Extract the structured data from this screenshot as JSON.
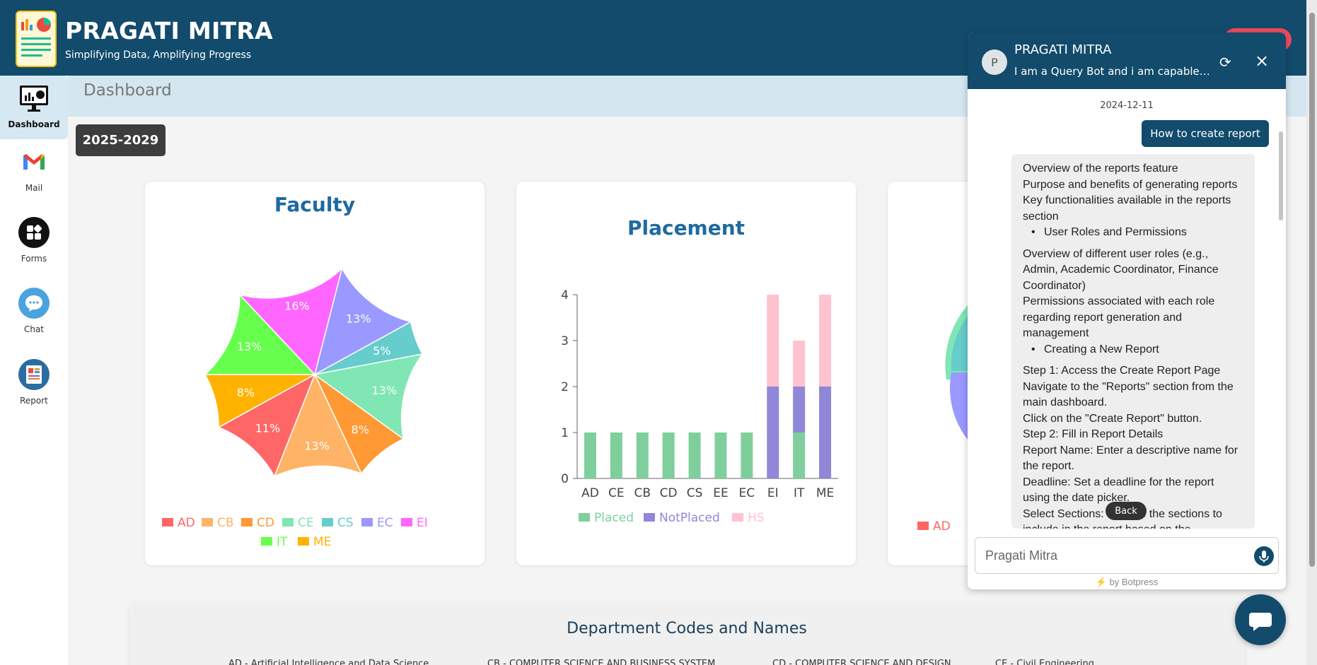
{
  "header": {
    "brand_title": "PRAGATI MITRA",
    "brand_subtitle": "Simplifying Data, Amplifying Progress"
  },
  "sidebar": {
    "items": [
      {
        "label": "Dashboard",
        "icon": "dashboard-monitor-icon",
        "active": true
      },
      {
        "label": "Mail",
        "icon": "gmail-icon"
      },
      {
        "label": "Forms",
        "icon": "forms-grid-icon"
      },
      {
        "label": "Chat",
        "icon": "chat-bubble-icon"
      },
      {
        "label": "Report",
        "icon": "report-icon"
      }
    ]
  },
  "dashboard": {
    "title": "Dashboard",
    "year": "2025-2029"
  },
  "faculty_card": {
    "title": "Faculty",
    "chart_data": {
      "type": "pie",
      "slices": [
        {
          "label": "IT",
          "value": 13,
          "color": "#66ff4d"
        },
        {
          "label": "EI",
          "value": 16,
          "color": "#ff66ff"
        },
        {
          "label": "EC",
          "value": 13,
          "color": "#9999ff"
        },
        {
          "label": "CS",
          "value": 5,
          "color": "#66cccc"
        },
        {
          "label": "CE",
          "value": 13,
          "color": "#80e6b3"
        },
        {
          "label": "CD",
          "value": 8,
          "color": "#ff9933"
        },
        {
          "label": "CB",
          "value": 13,
          "color": "#ffb366"
        },
        {
          "label": "AD",
          "value": 11,
          "color": "#ff6666"
        },
        {
          "label": "ME",
          "value": 8,
          "color": "#ffb300"
        }
      ],
      "slice_labels": [
        "13%",
        "16%",
        "13%",
        "5%",
        "13%",
        "8%",
        "13%",
        "11%",
        "8%"
      ],
      "legend": [
        "AD",
        "CB",
        "CD",
        "CE",
        "CS",
        "EC",
        "EI",
        "IT",
        "ME"
      ]
    }
  },
  "placement_card": {
    "title": "Placement",
    "chart_data": {
      "type": "bar",
      "stacked": true,
      "categories": [
        "AD",
        "CE",
        "CB",
        "CD",
        "CS",
        "EE",
        "EC",
        "EI",
        "IT",
        "ME"
      ],
      "series": [
        {
          "name": "Placed",
          "color": "#7fcf9c",
          "values": [
            1,
            1,
            1,
            1,
            1,
            1,
            1,
            0,
            1,
            0
          ]
        },
        {
          "name": "NotPlaced",
          "color": "#9087d8",
          "values": [
            0,
            0,
            0,
            0,
            0,
            0,
            0,
            2,
            1,
            2
          ]
        },
        {
          "name": "HS",
          "color": "#ffc2cf",
          "values": [
            0,
            0,
            0,
            0,
            0,
            0,
            0,
            2,
            1,
            2
          ]
        }
      ],
      "yticks": [
        "0",
        "1",
        "2",
        "3",
        "4"
      ],
      "ylim": [
        0,
        4
      ]
    }
  },
  "third_card": {
    "legend": [
      "AD"
    ]
  },
  "departments": {
    "title": "Department Codes and Names",
    "chips": [
      {
        "text": "AD - Artificial Intelligence and Data Science",
        "color": "#ff6b6b"
      },
      {
        "text": "CB - COMPUTER SCIENCE AND BUSINESS SYSTEM",
        "color": "#ffb366"
      },
      {
        "text": "CD - COMPUTER SCIENCE AND DESIGN",
        "color": "#ff9933"
      },
      {
        "text": "CE - Civil Engineering",
        "color": "#80e6b3"
      }
    ]
  },
  "chat": {
    "avatar_letter": "P",
    "name": "PRAGATI MITRA",
    "description": "I am a Query Bot and i am capable o...",
    "date": "2024-12-11",
    "user_message": "How to create report",
    "bot_lines": [
      {
        "t": "Overview of the reports feature"
      },
      {
        "t": "Purpose and benefits of generating reports"
      },
      {
        "t": "Key functionalities available in the reports section"
      },
      {
        "t": "User Roles and Permissions",
        "bullet": true
      },
      {
        "t": "Overview of different user roles (e.g., Admin, Academic Coordinator, Finance Coordinator)"
      },
      {
        "t": "Permissions associated with each role regarding report generation and management"
      },
      {
        "t": "Creating a New Report",
        "bullet": true
      },
      {
        "t": "Step 1: Access the Create Report Page"
      },
      {
        "t": "Navigate to the \"Reports\" section from the main dashboard."
      },
      {
        "t": "Click on the \"Create Report\" button."
      },
      {
        "t": "Step 2: Fill in Report Details"
      },
      {
        "t": "Report Name: Enter a descriptive name for the report."
      },
      {
        "t": "Deadline: Set a deadline for the report using the date picker."
      },
      {
        "t": "Select Sections: Choose the sections to include in the report based on the..."
      }
    ],
    "back_label": "Back",
    "input_placeholder": "Pragati Mitra",
    "powered_by": "by Botpress"
  }
}
